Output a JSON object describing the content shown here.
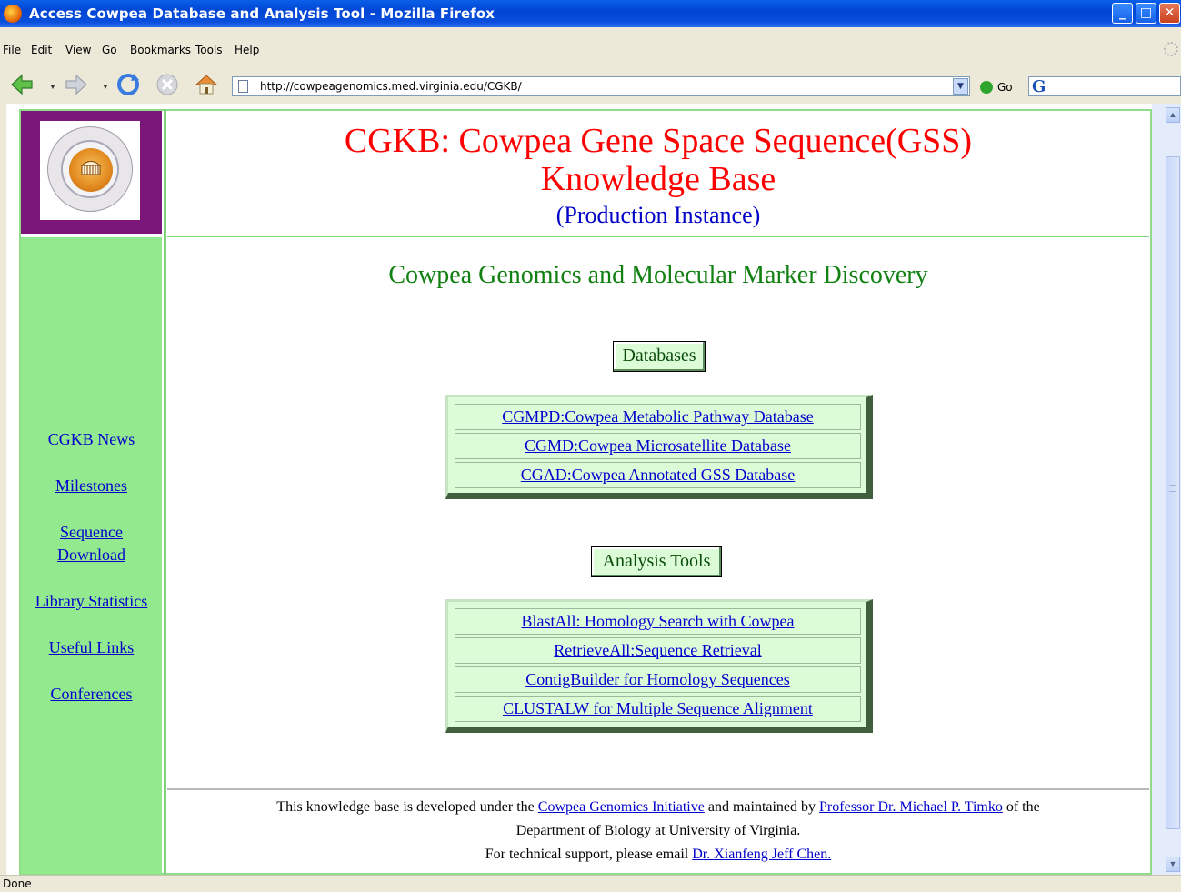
{
  "window": {
    "title": "Access Cowpea Database and Analysis Tool - Mozilla Firefox"
  },
  "menu": {
    "items": [
      "File",
      "Edit",
      "View",
      "Go",
      "Bookmarks",
      "Tools",
      "Help"
    ]
  },
  "navbar": {
    "url": "http://cowpeagenomics.med.virginia.edu/CGKB/",
    "go_label": "Go",
    "search_logo": "G"
  },
  "page": {
    "title_line1": "CGKB: Cowpea Gene Space Sequence(GSS)",
    "title_line2": "Knowledge Base",
    "title_line3": "(Production Instance)",
    "subtitle": "Cowpea Genomics and Molecular Marker Discovery",
    "sidebar_links": [
      "CGKB News",
      "Milestones",
      "Sequence",
      "Download",
      "Library Statistics",
      "Useful Links",
      "Conferences"
    ],
    "databases_label": "Databases",
    "databases": [
      "CGMPD:Cowpea Metabolic Pathway Database",
      "CGMD:Cowpea Microsatellite Database",
      "CGAD:Cowpea Annotated GSS Database"
    ],
    "tools_label": "Analysis Tools",
    "tools": [
      "BlastAll: Homology Search with Cowpea",
      "RetrieveAll:Sequence Retrieval",
      "ContigBuilder for Homology Sequences",
      "CLUSTALW for Multiple Sequence Alignment"
    ],
    "footer": {
      "text1": "This knowledge base is developed under the ",
      "link1": "Cowpea Genomics Initiative",
      "text2": " and maintained by ",
      "link2": "Professor Dr. Michael P. Timko",
      "text3": " of the",
      "line2": "Department of Biology at University of Virginia.",
      "text4": "For technical support, please email ",
      "link3": "Dr. Xianfeng Jeff Chen."
    }
  },
  "status": {
    "text": "Done"
  }
}
